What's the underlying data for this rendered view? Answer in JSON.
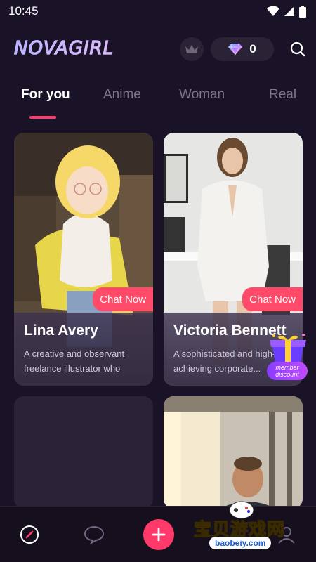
{
  "status": {
    "time": "10:45"
  },
  "app": {
    "logo": "NOVAGIRL",
    "gems": "0"
  },
  "tabs": [
    {
      "label": "For you",
      "active": true
    },
    {
      "label": "Anime",
      "active": false
    },
    {
      "label": "Woman",
      "active": false
    },
    {
      "label": "Real",
      "active": false
    }
  ],
  "cards": [
    {
      "name": "Lina Avery",
      "desc": "A creative and observant freelance illustrator who find...",
      "cta": "Chat Now"
    },
    {
      "name": "Victoria Bennett",
      "desc": "A sophisticated and high-achieving corporate...",
      "cta": "Chat Now"
    }
  ],
  "badge": {
    "line1": "member",
    "line2": "discount"
  },
  "watermark": {
    "cn": "宝贝游戏网",
    "url": "baobeiy.com"
  },
  "colors": {
    "accent": "#ff3a6b",
    "background": "#1a1226",
    "card": "#2a2236"
  }
}
